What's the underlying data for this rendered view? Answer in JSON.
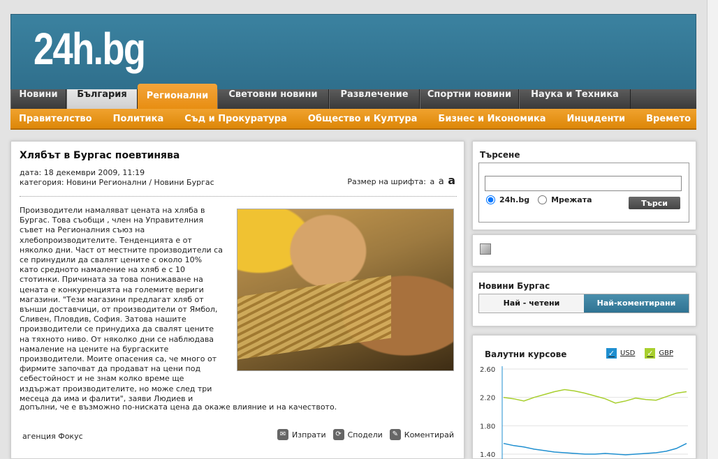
{
  "site": {
    "logo": "24h.bg"
  },
  "nav_main": [
    {
      "label": "Новини",
      "state": "normal",
      "w": 80
    },
    {
      "label": "България",
      "state": "inactive-light",
      "w": 102
    },
    {
      "label": "Регионални",
      "state": "active",
      "w": 114
    },
    {
      "label": "Световни новини",
      "state": "normal",
      "w": 160
    },
    {
      "label": "Развлечение",
      "state": "normal",
      "w": 130
    },
    {
      "label": "Спортни новини",
      "state": "normal",
      "w": 142
    },
    {
      "label": "Наука и Техника",
      "state": "normal",
      "w": 160
    }
  ],
  "nav_sub": [
    "Правителство",
    "Политика",
    "Съд и Прокуратура",
    "Общество и Култура",
    "Бизнес и Икономика",
    "Инциденти",
    "Времето"
  ],
  "article": {
    "title": "Хлябът в Бургас поевтинява",
    "date": "дата: 18 декември 2009, 11:19",
    "category": "категория: Новини Регионални / Новини Бургас",
    "font_size_label": "Размер на шрифта:",
    "font_sizes": [
      "a",
      "a",
      "a"
    ],
    "body": "Производители намаляват цената на хляба в\nБургас. Това съобщи , член на Управителния\nсъвет на Регионалния съюз на\nхлебопроизводителите. Тенденцията е от\nняколко дни. Част от местните производители са\nсе принудили да свалят цените с около 10%\nкато средното намаление на хляб е с 10\nстотинки. Причината за това понижаване на\nцената е конкуренцията на големите вериги\nмагазини. \"Тези магазини предлагат хляб от\nвънши доставчици, от производители от Ямбол,\nСливен, Пловдив, София. Затова нашите\nпроизводители се принудиха да свалят цените\nна тяхното ниво. От няколко дни се наблюдава\nнамаление на цените на бургаските\nпроизводители. Моите опасения са, че много от\nфирмите започват да продават на цени под\nсебестойност и не знам колко време ще\nиздържат производителите, но може след три\nмесеца да има и фалити\", заяви Людиев и",
    "body_tail": "допълни, че е възможно по-ниската цена да окаже влияние и на качеството.",
    "source": "агенция Фокус",
    "actions": [
      {
        "label": "Изпрати",
        "icon": "envelope-icon",
        "glyph": "✉"
      },
      {
        "label": "Сподели",
        "icon": "share-icon",
        "glyph": "⟳"
      },
      {
        "label": "Коментирай",
        "icon": "comment-icon",
        "glyph": "✎"
      }
    ]
  },
  "search": {
    "title": "Търсене",
    "value": "",
    "option1": "24h.bg",
    "option2": "Мрежата",
    "button": "Търси"
  },
  "news_box": {
    "title": "Новини Бургас",
    "tab1": "Най - четени",
    "tab2": "Най-коментирани"
  },
  "fx": {
    "title": "Валутни курсове",
    "usd_label": "USD",
    "gbp_label": "GBP",
    "usd_color": "#1f8fd0",
    "gbp_color": "#a8cf2e"
  },
  "chart_data": {
    "type": "line",
    "title": "Валутни курсове",
    "ylim": [
      1.4,
      2.6
    ],
    "yticks": [
      "2.60",
      "2.20",
      "1.80",
      "1.40"
    ],
    "series": [
      {
        "name": "USD",
        "color": "#1f8fd0",
        "values": [
          1.55,
          1.52,
          1.5,
          1.47,
          1.45,
          1.43,
          1.42,
          1.41,
          1.4,
          1.4,
          1.41,
          1.4,
          1.39,
          1.4,
          1.41,
          1.42,
          1.44,
          1.48,
          1.55
        ]
      },
      {
        "name": "GBP",
        "color": "#a8cf2e",
        "values": [
          2.2,
          2.18,
          2.15,
          2.2,
          2.24,
          2.28,
          2.31,
          2.29,
          2.26,
          2.22,
          2.18,
          2.12,
          2.15,
          2.19,
          2.17,
          2.16,
          2.21,
          2.26,
          2.28
        ]
      }
    ]
  }
}
